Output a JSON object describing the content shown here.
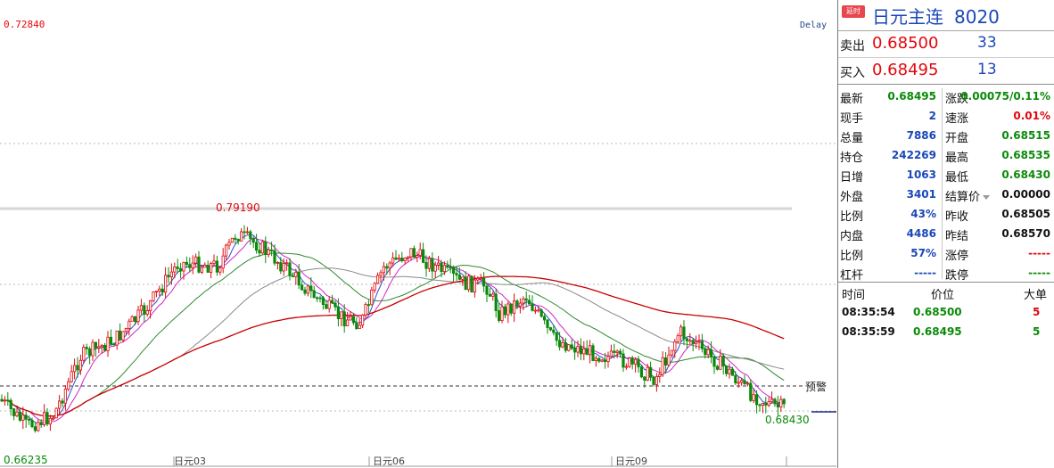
{
  "chart": {
    "price_high_label": "0.72840",
    "delay_label": "Delay",
    "peak_label": "0.79190",
    "low_label": "0.66235",
    "last_low_label": "0.68430",
    "warning_label": "预警",
    "date_labels": [
      "日元03",
      "日元06",
      "日元09"
    ],
    "colors": {
      "up": "#e2080e",
      "down": "#0a8a0a",
      "ma_red": "#c80000",
      "ma_green": "#2f8a2f",
      "ma_gray": "#8a8a8a",
      "ma_magenta": "#d027c8",
      "ma_blue": "#2d4fd0"
    }
  },
  "panel": {
    "badge": "延时",
    "title": "日元主连",
    "code": "8020",
    "sell": {
      "label": "卖出",
      "price": "0.68500",
      "volume": "33"
    },
    "buy": {
      "label": "买入",
      "price": "0.68495",
      "volume": "13"
    },
    "left_stats": [
      {
        "label": "最新",
        "value": "0.68495",
        "color": "green"
      },
      {
        "label": "现手",
        "value": "2",
        "color": "blue"
      },
      {
        "label": "总量",
        "value": "7886",
        "color": "blue"
      },
      {
        "label": "持仓",
        "value": "242269",
        "color": "blue"
      },
      {
        "label": "日增",
        "value": "1063",
        "color": "blue"
      },
      {
        "label": "外盘",
        "value": "3401",
        "color": "blue"
      },
      {
        "label": "比例",
        "value": "43%",
        "color": "blue"
      },
      {
        "label": "内盘",
        "value": "4486",
        "color": "blue"
      },
      {
        "label": "比例",
        "value": "57%",
        "color": "blue"
      },
      {
        "label": "杠杆",
        "value": "-----",
        "color": "blue"
      }
    ],
    "right_stats": [
      {
        "label": "涨跌",
        "value": "0.00075/0.11%",
        "color": "green"
      },
      {
        "label": "速涨",
        "value": "0.01%",
        "color": "red"
      },
      {
        "label": "开盘",
        "value": "0.68515",
        "color": "green"
      },
      {
        "label": "最高",
        "value": "0.68535",
        "color": "green"
      },
      {
        "label": "最低",
        "value": "0.68430",
        "color": "green"
      },
      {
        "label": "结算价",
        "value": "0.00000",
        "color": "dark",
        "dropdown": true
      },
      {
        "label": "昨收",
        "value": "0.68505",
        "color": "dark"
      },
      {
        "label": "昨结",
        "value": "0.68570",
        "color": "dark"
      },
      {
        "label": "涨停",
        "value": "-----",
        "color": "red"
      },
      {
        "label": "跌停",
        "value": "-----",
        "color": "green"
      }
    ],
    "trades_header": {
      "time": "时间",
      "price": "价位",
      "size": "大单"
    },
    "trades": [
      {
        "time": "08:35:54",
        "price": "0.68500",
        "size": "5",
        "size_color": "red"
      },
      {
        "time": "08:35:59",
        "price": "0.68495",
        "size": "5",
        "size_color": "green"
      }
    ]
  }
}
